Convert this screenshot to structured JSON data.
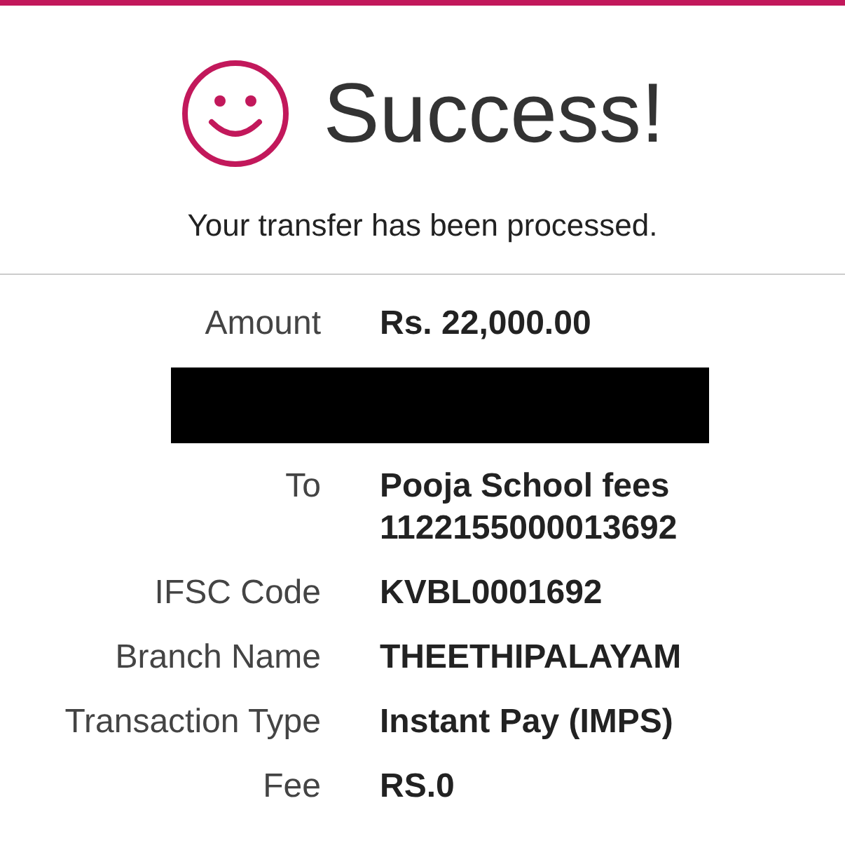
{
  "header": {
    "title": "Success!",
    "message": "Your transfer has been processed."
  },
  "details": [
    {
      "kind": "field",
      "label": "Amount",
      "values": [
        "Rs. 22,000.00"
      ]
    },
    {
      "kind": "redacted"
    },
    {
      "kind": "field",
      "label": "To",
      "values": [
        "Pooja School fees",
        "1122155000013692"
      ]
    },
    {
      "kind": "field",
      "label": "IFSC Code",
      "values": [
        "KVBL0001692"
      ]
    },
    {
      "kind": "field",
      "label": "Branch Name",
      "values": [
        "THEETHIPALAYAM"
      ]
    },
    {
      "kind": "field",
      "label": "Transaction Type",
      "values": [
        "Instant Pay (IMPS)"
      ]
    },
    {
      "kind": "field",
      "label": "Fee",
      "values": [
        "RS.0"
      ]
    }
  ]
}
